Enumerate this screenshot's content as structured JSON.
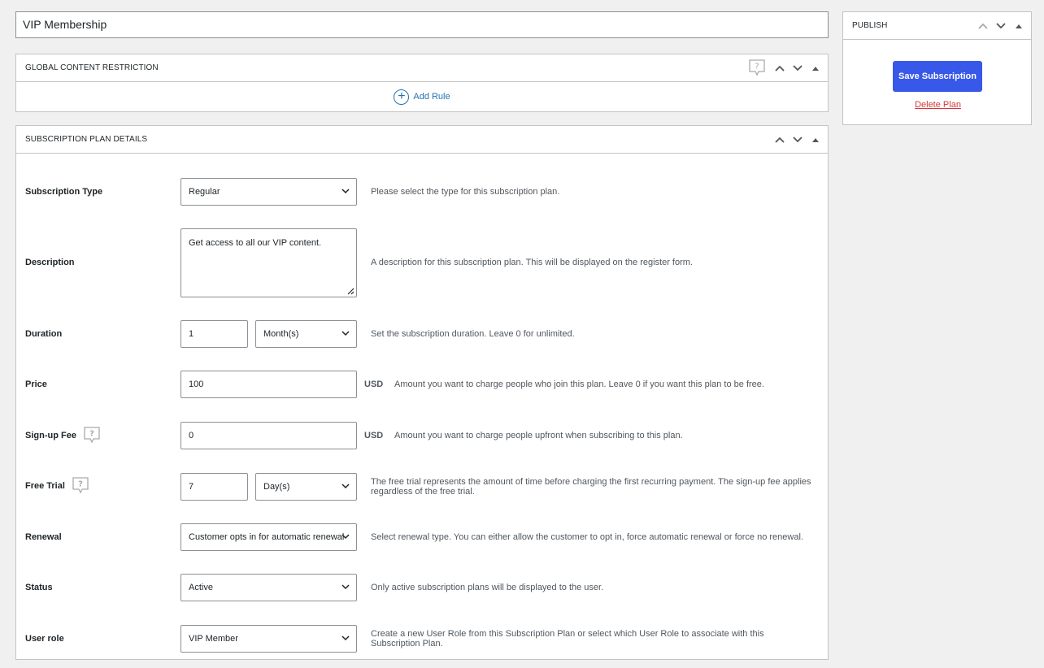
{
  "title_input": {
    "value": "VIP Membership"
  },
  "global_content_restriction": {
    "title": "GLOBAL CONTENT RESTRICTION",
    "add_rule_label": "Add Rule"
  },
  "publish": {
    "title": "PUBLISH",
    "save_label": "Save Subscription",
    "delete_label": "Delete Plan"
  },
  "details": {
    "title": "SUBSCRIPTION PLAN DETAILS",
    "subscription_type": {
      "label": "Subscription Type",
      "value": "Regular",
      "description": "Please select the type for this subscription plan."
    },
    "description": {
      "label": "Description",
      "value": "Get access to all our VIP content.",
      "description": "A description for this subscription plan. This will be displayed on the register form."
    },
    "duration": {
      "label": "Duration",
      "value": "1",
      "unit": "Month(s)",
      "description": "Set the subscription duration. Leave 0 for unlimited."
    },
    "price": {
      "label": "Price",
      "value": "100",
      "currency": "USD",
      "description": "Amount you want to charge people who join this plan. Leave 0 if you want this plan to be free."
    },
    "signup_fee": {
      "label": "Sign-up Fee",
      "value": "0",
      "currency": "USD",
      "description": "Amount you want to charge people upfront when subscribing to this plan."
    },
    "free_trial": {
      "label": "Free Trial",
      "value": "7",
      "unit": "Day(s)",
      "description": "The free trial represents the amount of time before charging the first recurring payment. The sign-up fee applies regardless of the free trial."
    },
    "renewal": {
      "label": "Renewal",
      "value": "Customer opts in for automatic renewal",
      "description": "Select renewal type. You can either allow the customer to opt in, force automatic renewal or force no renewal."
    },
    "status": {
      "label": "Status",
      "value": "Active",
      "description": "Only active subscription plans will be displayed to the user."
    },
    "user_role": {
      "label": "User role",
      "value": "VIP Member",
      "description": "Create a new User Role from this Subscription Plan or select which User Role to associate with this Subscription Plan."
    }
  },
  "icons": {
    "move_up": "chevron-up-icon",
    "move_down": "chevron-down-icon",
    "toggle": "caret-up-icon",
    "help": "help-bubble-icon",
    "add": "plus-circle-icon",
    "select_arrow": "chevron-down-icon"
  },
  "colors": {
    "primary_button": "#3858e9",
    "link": "#2271b1",
    "danger_link": "#d63638",
    "page_background": "#f0f0f1"
  }
}
